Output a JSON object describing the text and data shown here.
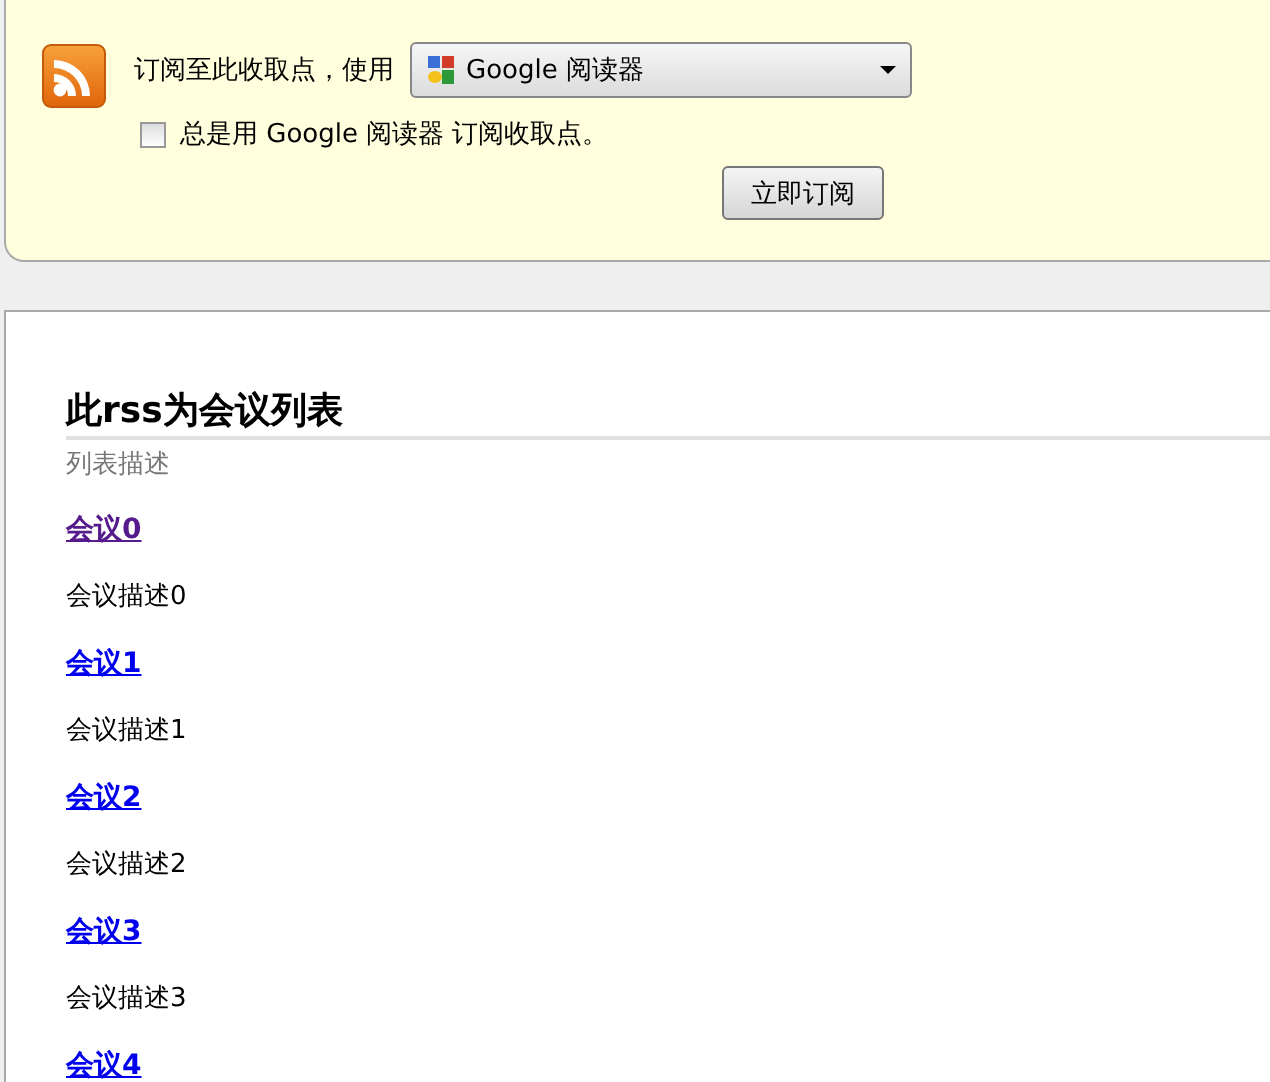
{
  "subscribe_bar": {
    "label": "订阅至此收取点，使用",
    "reader_select": {
      "value": "Google 阅读器"
    },
    "always_use": {
      "label": "总是用 Google 阅读器 订阅收取点。",
      "checked": false
    },
    "button": "立即订阅"
  },
  "feed": {
    "title": "此rss为会议列表",
    "description": "列表描述",
    "items": [
      {
        "title": "会议0",
        "visited": true,
        "description": "会议描述0"
      },
      {
        "title": "会议1",
        "visited": false,
        "description": "会议描述1"
      },
      {
        "title": "会议2",
        "visited": false,
        "description": "会议描述2"
      },
      {
        "title": "会议3",
        "visited": false,
        "description": "会议描述3"
      },
      {
        "title": "会议4",
        "visited": false
      }
    ]
  }
}
